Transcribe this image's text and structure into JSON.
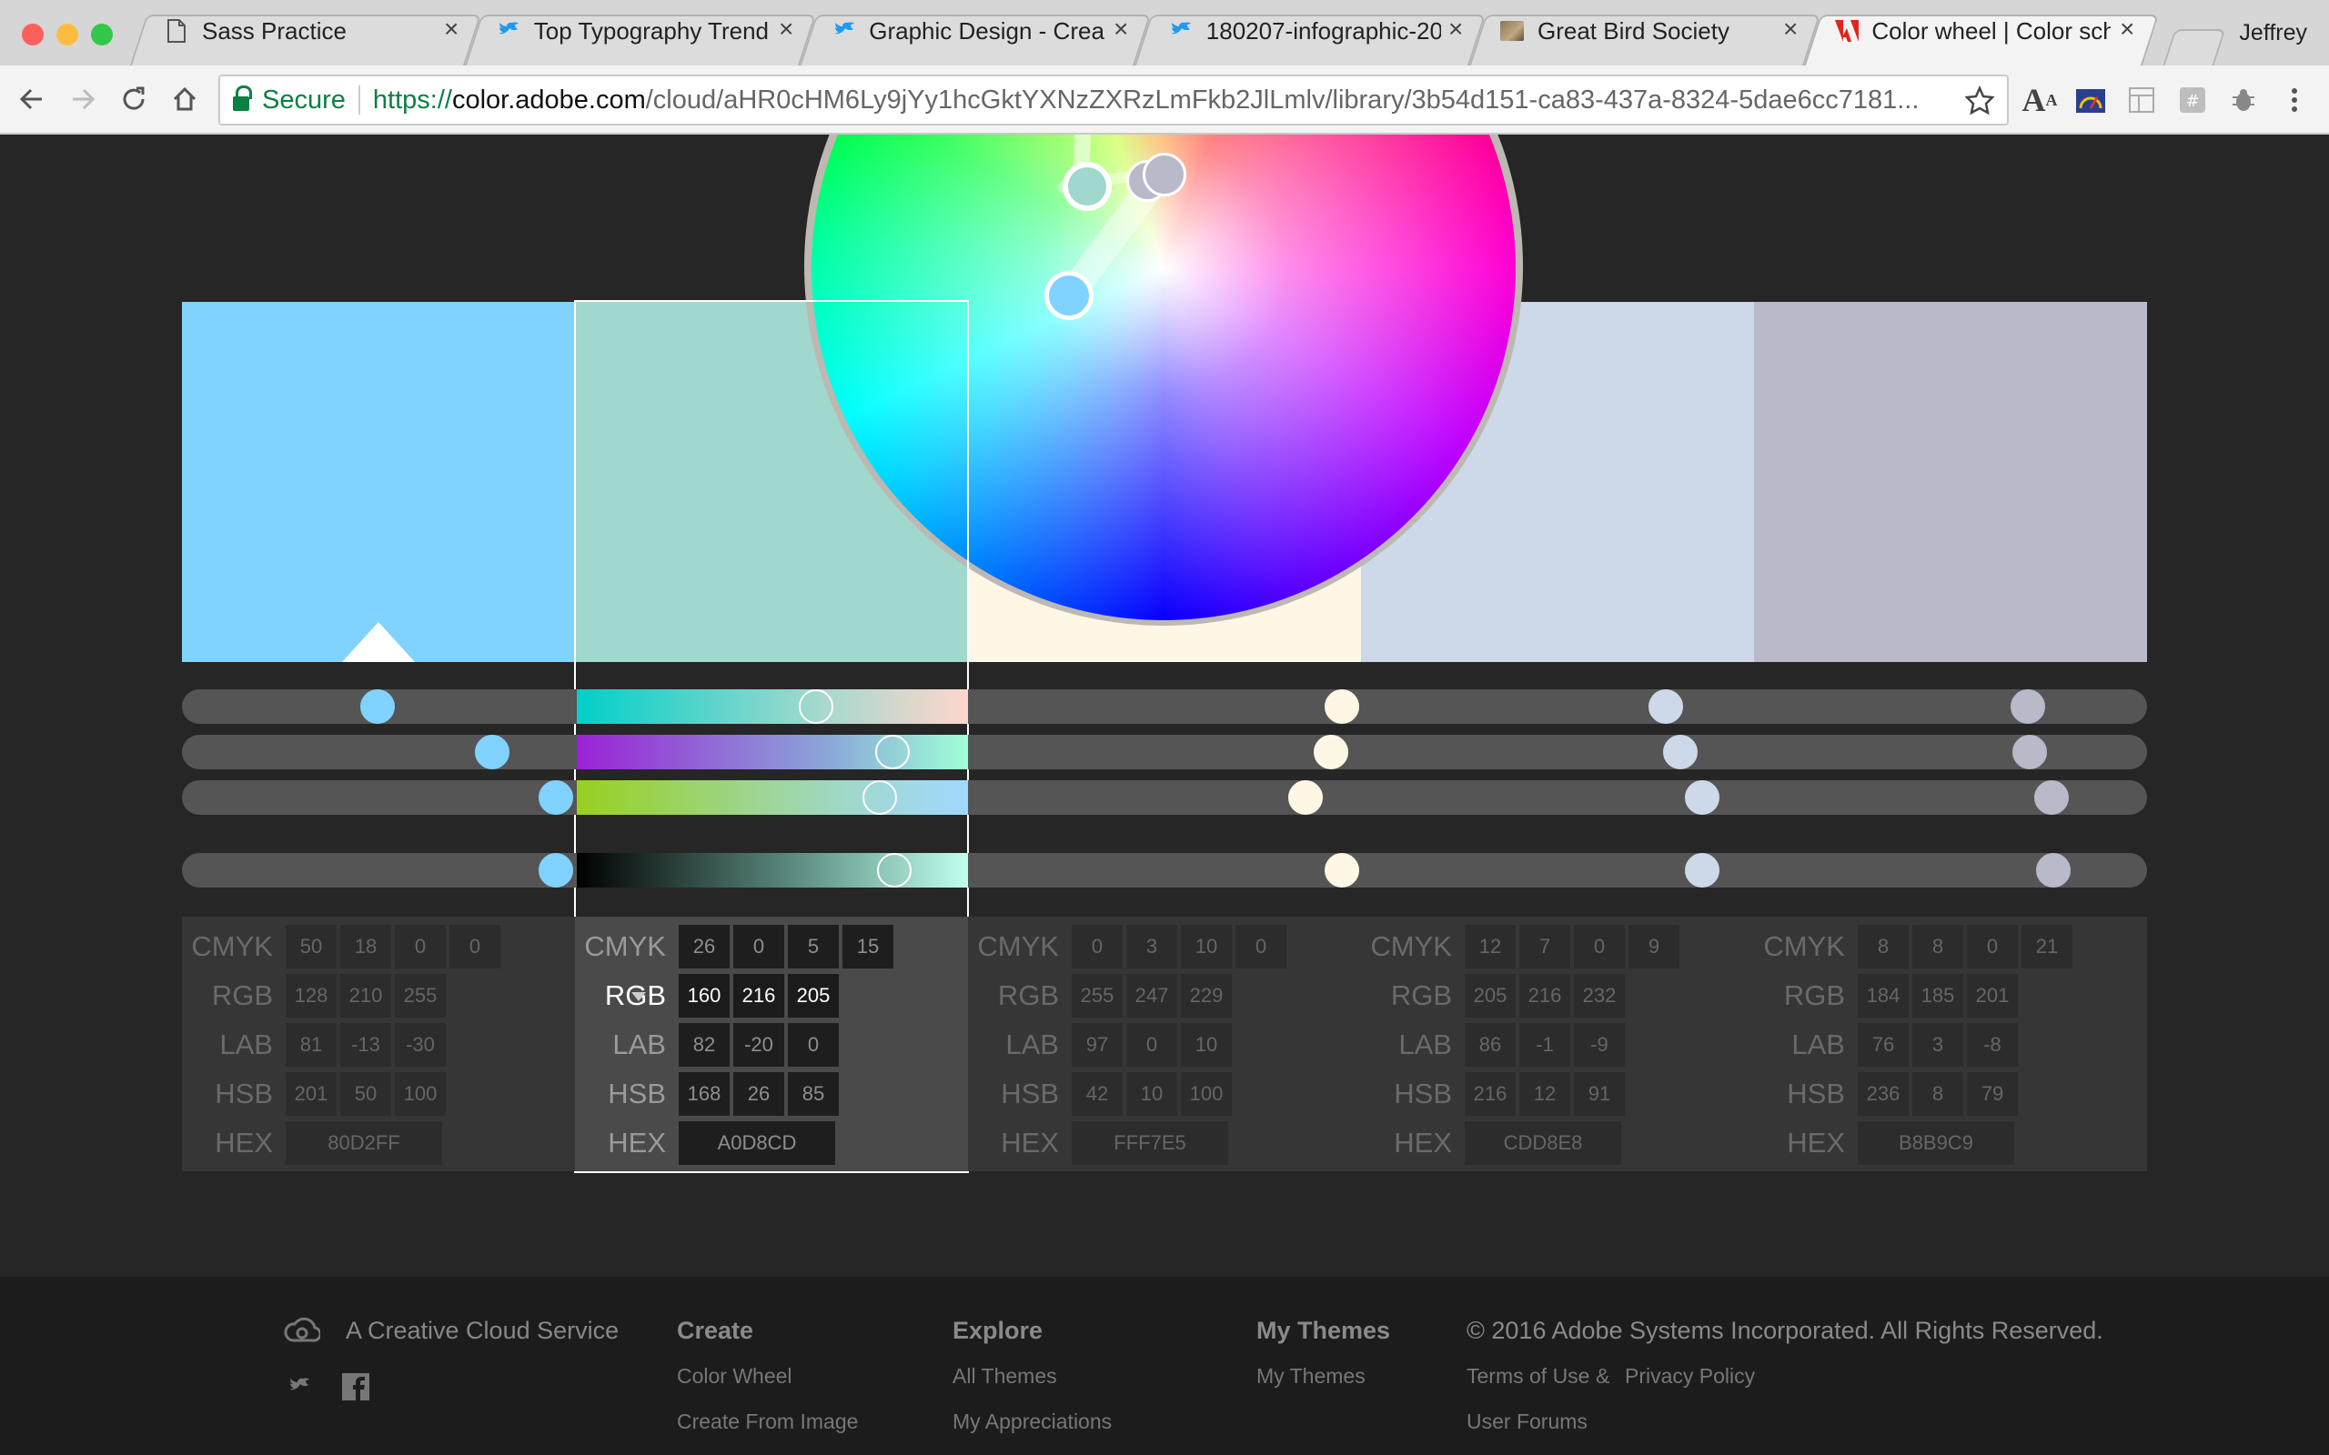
{
  "browser": {
    "tabs": [
      {
        "title": "Sass Practice",
        "icon": "document-icon"
      },
      {
        "title": "Top Typography Trends",
        "icon": "bird-icon"
      },
      {
        "title": "Graphic Design - Creat",
        "icon": "bird-icon"
      },
      {
        "title": "180207-infographic-20",
        "icon": "bird-icon"
      },
      {
        "title": "Great Bird Society",
        "icon": "bird-photo-icon"
      },
      {
        "title": "Color wheel | Color sch",
        "icon": "adobe-icon"
      }
    ],
    "profile_name": "Jeffrey",
    "address": {
      "secure_label": "Secure",
      "scheme": "https://",
      "host": "color.adobe.com",
      "path": "/cloud/aHR0cHM6Ly9jYy1hcGktYXNzZXRzLmFkb2JlLmlv/library/3b54d151-ca83-437a-8324-5dae6cc7181..."
    }
  },
  "swatches": [
    {
      "hex": "#80D2FF",
      "selected": false,
      "base": true
    },
    {
      "hex": "#A0D8CD",
      "selected": true,
      "base": false
    },
    {
      "hex": "#FFF7E5",
      "selected": false,
      "base": false
    },
    {
      "hex": "#CDD8E8",
      "selected": false,
      "base": false
    },
    {
      "hex": "#B8B9C9",
      "selected": false,
      "base": false
    }
  ],
  "color_values": [
    {
      "cmyk": [
        "50",
        "18",
        "0",
        "0"
      ],
      "rgb": [
        "128",
        "210",
        "255"
      ],
      "lab": [
        "81",
        "-13",
        "-30"
      ],
      "hsb": [
        "201",
        "50",
        "100"
      ],
      "hex": "80D2FF"
    },
    {
      "cmyk": [
        "26",
        "0",
        "5",
        "15"
      ],
      "rgb": [
        "160",
        "216",
        "205"
      ],
      "lab": [
        "82",
        "-20",
        "0"
      ],
      "hsb": [
        "168",
        "26",
        "85"
      ],
      "hex": "A0D8CD"
    },
    {
      "cmyk": [
        "0",
        "3",
        "10",
        "0"
      ],
      "rgb": [
        "255",
        "247",
        "229"
      ],
      "lab": [
        "97",
        "0",
        "10"
      ],
      "hsb": [
        "42",
        "10",
        "100"
      ],
      "hex": "FFF7E5"
    },
    {
      "cmyk": [
        "12",
        "7",
        "0",
        "9"
      ],
      "rgb": [
        "205",
        "216",
        "232"
      ],
      "lab": [
        "86",
        "-1",
        "-9"
      ],
      "hsb": [
        "216",
        "12",
        "91"
      ],
      "hex": "CDD8E8"
    },
    {
      "cmyk": [
        "8",
        "8",
        "0",
        "21"
      ],
      "rgb": [
        "184",
        "185",
        "201"
      ],
      "lab": [
        "76",
        "3",
        "-8"
      ],
      "hsb": [
        "236",
        "8",
        "79"
      ],
      "hex": "B8B9C9"
    }
  ],
  "labels": {
    "cmyk": "CMYK",
    "rgb": "RGB",
    "lab": "LAB",
    "hsb": "HSB",
    "hex": "HEX"
  },
  "footer": {
    "service": "A Creative Cloud Service",
    "create": {
      "heading": "Create",
      "links": [
        "Color Wheel",
        "Create From Image"
      ]
    },
    "explore": {
      "heading": "Explore",
      "links": [
        "All Themes",
        "My Appreciations"
      ]
    },
    "my_themes": {
      "heading": "My Themes",
      "links": [
        "My Themes"
      ]
    },
    "copyright": "© 2016 Adobe Systems Incorporated. All Rights Reserved.",
    "legal": {
      "terms": "Terms of Use",
      "amp": "&",
      "privacy": "Privacy Policy",
      "forums": "User Forums"
    }
  }
}
